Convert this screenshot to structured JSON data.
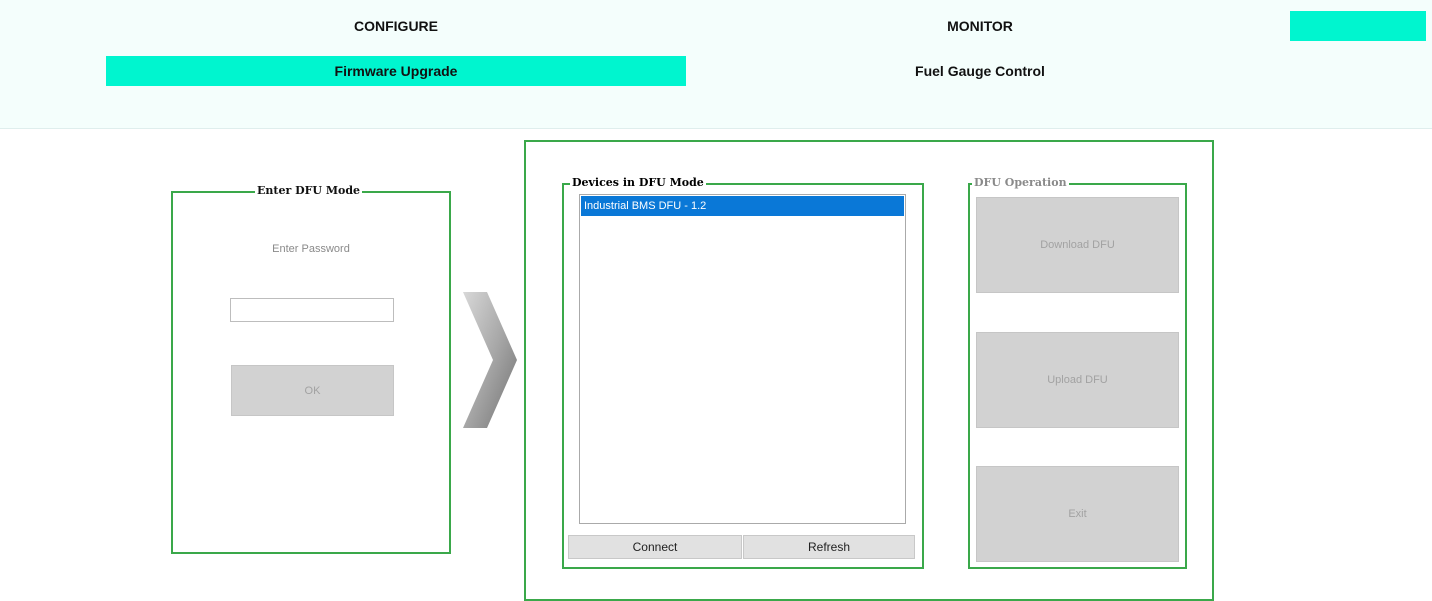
{
  "tabs": {
    "main": [
      "CONFIGURE",
      "MONITOR"
    ],
    "sub": [
      "Firmware Upgrade",
      "Fuel Gauge Control"
    ]
  },
  "enter_dfu": {
    "title": "Enter DFU Mode",
    "password_label": "Enter Password",
    "password_value": "",
    "ok_label": "OK"
  },
  "devices": {
    "title": "Devices in DFU Mode",
    "items": [
      "Industrial BMS DFU - 1.2"
    ],
    "connect_label": "Connect",
    "refresh_label": "Refresh"
  },
  "dfu_operation": {
    "title": "DFU Operation",
    "download_label": "Download DFU",
    "upload_label": "Upload DFU",
    "exit_label": "Exit"
  },
  "colors": {
    "accent": "#00f5cf",
    "group_border": "#3aa84a",
    "selection": "#0a78d7"
  },
  "icons": {
    "arrow": "chevron-right-icon"
  }
}
